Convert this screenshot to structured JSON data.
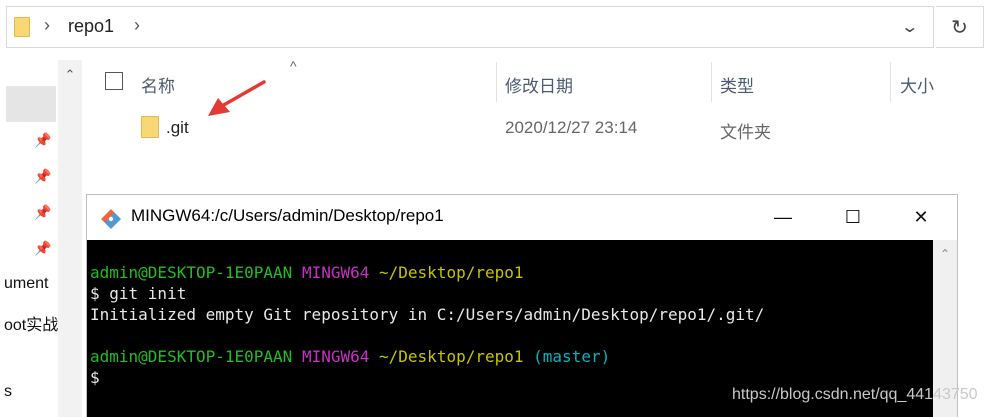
{
  "address_bar": {
    "path": "repo1",
    "folder_icon": "folder-icon",
    "dropdown_icon": "chevron-down-icon",
    "refresh_icon": "refresh-icon",
    "chevron": "›",
    "dropdown_glyph": "⌄",
    "refresh_glyph": "↻"
  },
  "nav_pane": {
    "scroll_up": "⌃",
    "pin_glyph": "📌",
    "items": [
      {
        "label": "ument"
      },
      {
        "label": "oot实战"
      },
      {
        "label": "s"
      }
    ]
  },
  "columns": {
    "sort_glyph": "^",
    "name": "名称",
    "date": "修改日期",
    "type": "类型",
    "size": "大小"
  },
  "files": [
    {
      "name": ".git",
      "date": "2020/12/27 23:14",
      "type": "文件夹"
    }
  ],
  "terminal": {
    "title": "MINGW64:/c/Users/admin/Desktop/repo1",
    "minimize": "—",
    "maximize": "☐",
    "close": "✕",
    "scroll_up": "⌃",
    "lines": [
      {
        "user": "admin@DESKTOP-1E0PAAN",
        "env": "MINGW64",
        "path": "~/Desktop/repo1",
        "branch": ""
      },
      {
        "text": "$ git init"
      },
      {
        "text": "Initialized empty Git repository in C:/Users/admin/Desktop/repo1/.git/"
      },
      {
        "user": "admin@DESKTOP-1E0PAAN",
        "env": "MINGW64",
        "path": "~/Desktop/repo1",
        "branch": "(master)"
      },
      {
        "text": "$"
      }
    ]
  },
  "colors": {
    "accent_arrow": "#e53935",
    "terminal_bg": "#000000",
    "prompt_user": "#25bc24",
    "prompt_env": "#c930c7",
    "prompt_path": "#c7c400",
    "prompt_branch": "#00b6c1"
  },
  "watermark": "https://blog.csdn.net/qq_44143750"
}
